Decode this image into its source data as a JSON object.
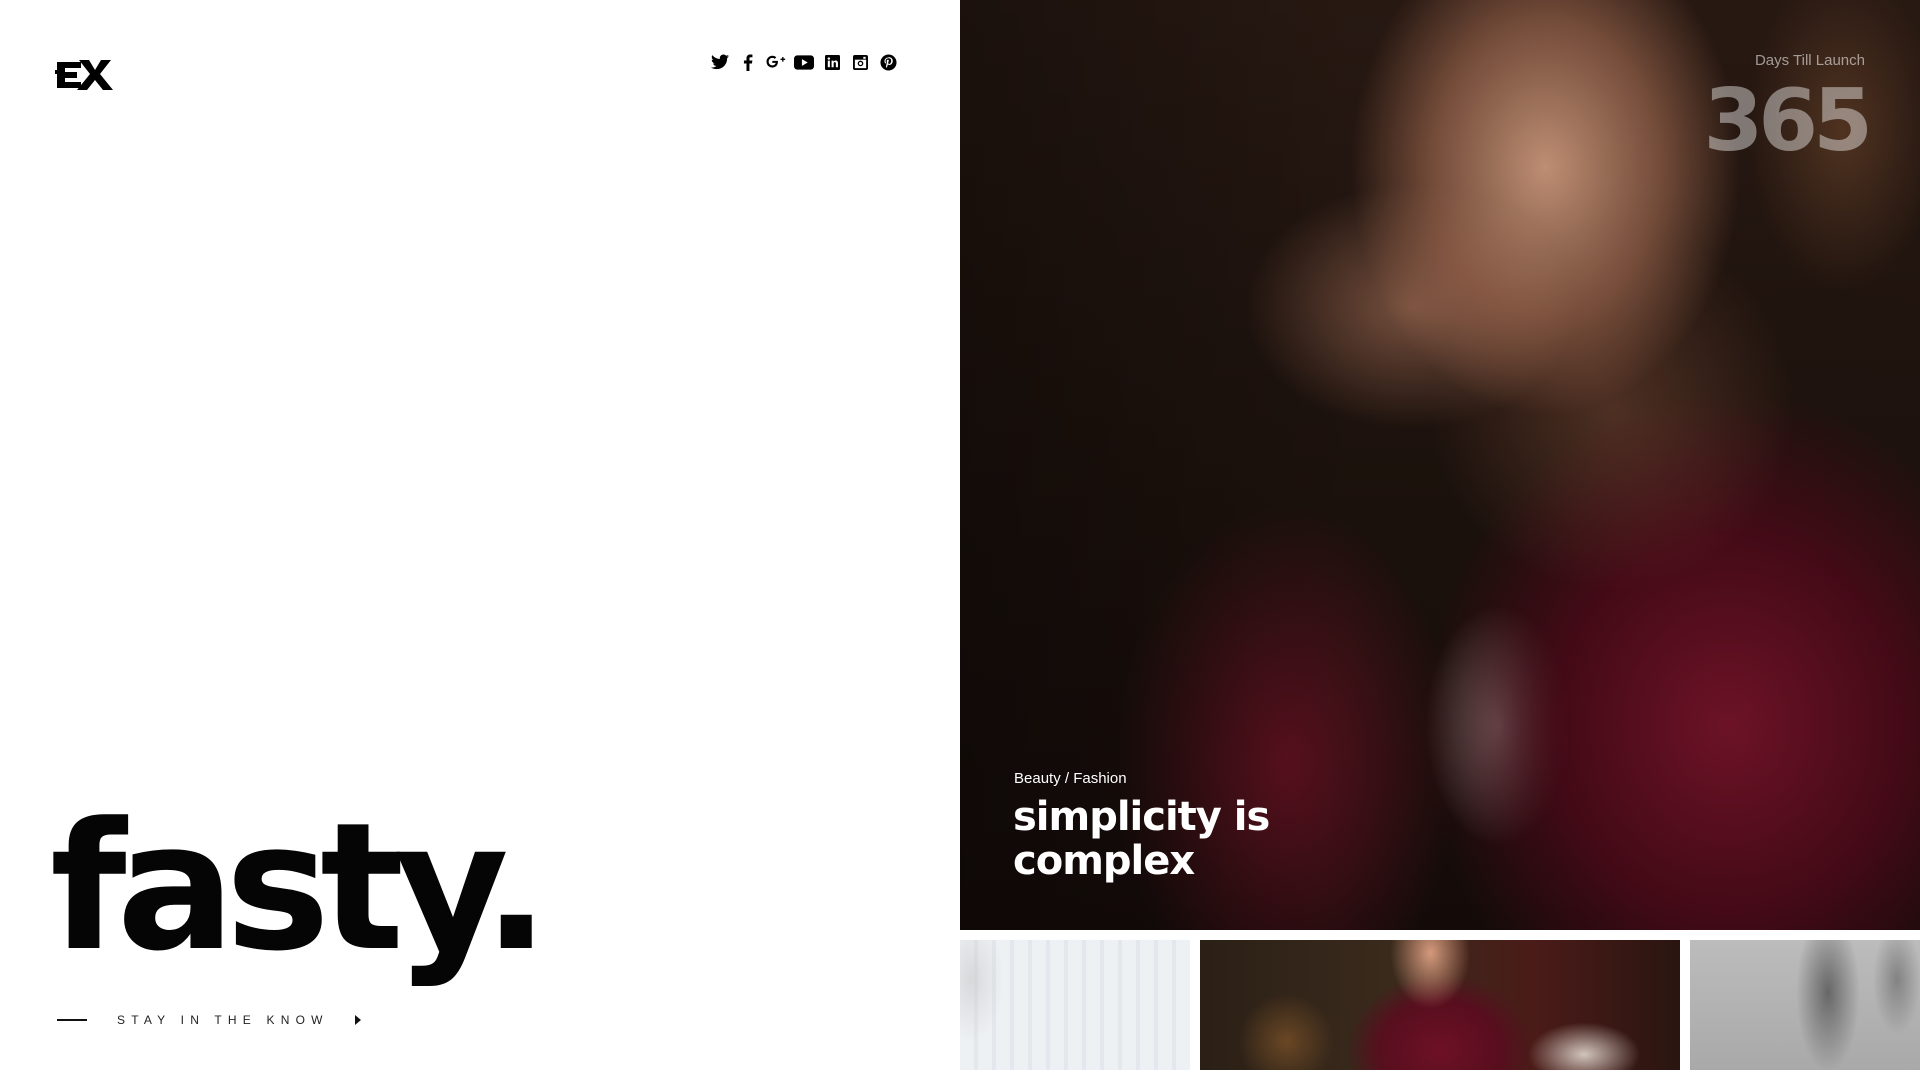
{
  "logo": {
    "icon": "ex-logo-icon"
  },
  "social": [
    {
      "name": "twitter-icon"
    },
    {
      "name": "facebook-icon"
    },
    {
      "name": "google-plus-icon"
    },
    {
      "name": "youtube-icon"
    },
    {
      "name": "linkedin-icon"
    },
    {
      "name": "instagram-icon"
    },
    {
      "name": "pinterest-icon"
    }
  ],
  "brand": {
    "name": "fasty."
  },
  "subscribe": {
    "label": "STAY IN THE KNOW",
    "icon": "caret-right-icon"
  },
  "countdown": {
    "label": "Days Till Launch",
    "value": "365"
  },
  "featured": {
    "category": "Beauty / Fashion",
    "headline": "simplicity is complex"
  },
  "thumbnails": [
    {
      "name": "thumbnail-1"
    },
    {
      "name": "thumbnail-2"
    },
    {
      "name": "thumbnail-3"
    }
  ],
  "colors": {
    "text": "#050505",
    "accent_wine": "#6e1026",
    "white": "#ffffff"
  }
}
